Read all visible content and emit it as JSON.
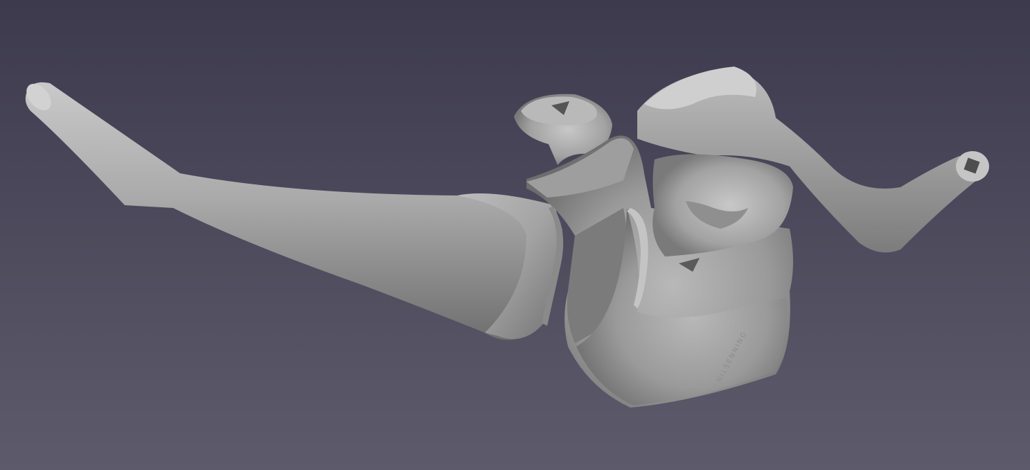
{
  "viewport": {
    "background_top": "#3d3a4e",
    "background_bottom": "#5d5b6b"
  },
  "model": {
    "surface_color": "#a6a6a6",
    "engraved_text": "NILSENNING"
  }
}
